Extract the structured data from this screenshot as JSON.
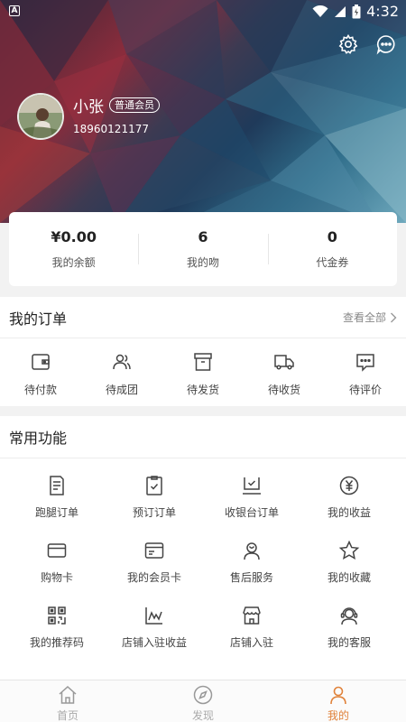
{
  "status_bar": {
    "time": "4:32",
    "notif_badge": "A"
  },
  "profile": {
    "name": "小张",
    "member_level": "普通会员",
    "phone": "18960121177"
  },
  "stats": [
    {
      "value": "¥0.00",
      "label": "我的余额"
    },
    {
      "value": "6",
      "label": "我的吻"
    },
    {
      "value": "0",
      "label": "代金券"
    }
  ],
  "orders": {
    "title": "我的订单",
    "view_all": "查看全部",
    "items": [
      {
        "label": "待付款",
        "icon": "wallet-icon"
      },
      {
        "label": "待成团",
        "icon": "group-icon"
      },
      {
        "label": "待发货",
        "icon": "box-icon"
      },
      {
        "label": "待收货",
        "icon": "truck-icon"
      },
      {
        "label": "待评价",
        "icon": "comment-icon"
      }
    ]
  },
  "functions": {
    "title": "常用功能",
    "items": [
      {
        "label": "跑腿订单",
        "icon": "document-icon"
      },
      {
        "label": "预订订单",
        "icon": "clipboard-check-icon"
      },
      {
        "label": "收银台订单",
        "icon": "cashier-icon"
      },
      {
        "label": "我的收益",
        "icon": "yuan-coin-icon"
      },
      {
        "label": "购物卡",
        "icon": "card-icon"
      },
      {
        "label": "我的会员卡",
        "icon": "member-card-icon"
      },
      {
        "label": "售后服务",
        "icon": "service-person-icon"
      },
      {
        "label": "我的收藏",
        "icon": "star-icon"
      },
      {
        "label": "我的推荐码",
        "icon": "qrcode-icon"
      },
      {
        "label": "店铺入驻收益",
        "icon": "chart-icon"
      },
      {
        "label": "店铺入驻",
        "icon": "shop-icon"
      },
      {
        "label": "我的客服",
        "icon": "headset-icon"
      }
    ]
  },
  "tabs": [
    {
      "label": "首页",
      "icon": "home-icon"
    },
    {
      "label": "发现",
      "icon": "compass-icon"
    },
    {
      "label": "我的",
      "icon": "user-icon"
    }
  ],
  "colors": {
    "accent": "#e0823a",
    "icon_gray": "#444444",
    "background": "#f2f2f2"
  }
}
